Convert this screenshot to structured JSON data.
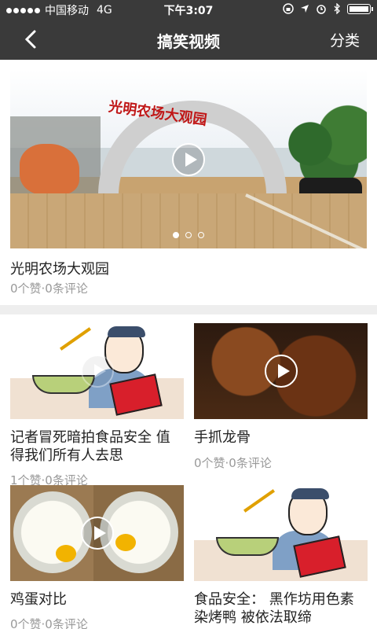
{
  "status_bar": {
    "carrier": "中国移动",
    "network": "4G",
    "time": "下午3:07"
  },
  "nav": {
    "title": "搞笑视频",
    "right_label": "分类"
  },
  "banner": {
    "sign_text": "光明农场大观园",
    "title": "光明农场大观园",
    "meta": "0个赞·0条评论",
    "slides": 3,
    "active_slide": 1
  },
  "videos": [
    {
      "title_lines": [
        "记者冒死暗拍食品安全 值",
        "得我们所有人去思"
      ],
      "meta": "1个赞·0条评论"
    },
    {
      "title_lines": [
        "手抓龙骨"
      ],
      "meta": "0个赞·0条评论"
    },
    {
      "title_lines": [
        "鸡蛋对比"
      ],
      "meta": "0个赞·0条评论"
    },
    {
      "title_lines": [
        "食品安全：  黑作坊用色素",
        "染烤鸭 被依法取缔"
      ],
      "meta": ""
    }
  ]
}
